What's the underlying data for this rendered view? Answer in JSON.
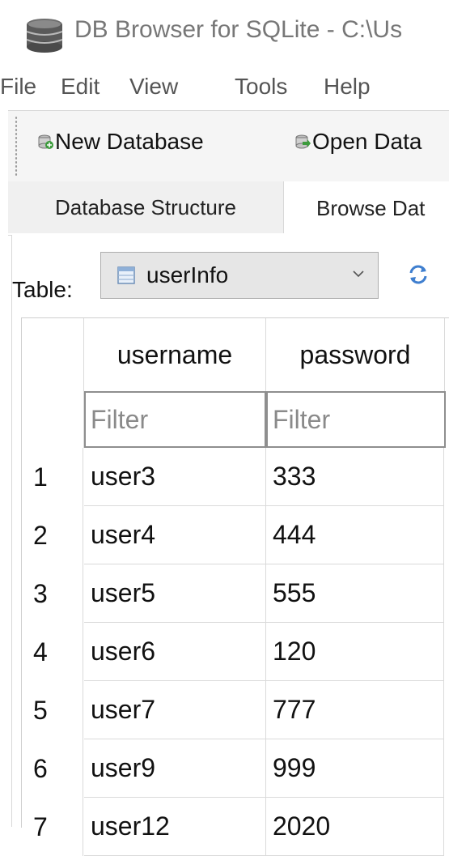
{
  "window": {
    "title": "DB Browser for SQLite - C:\\Us"
  },
  "menu": [
    "File",
    "Edit",
    "View",
    "Tools",
    "Help"
  ],
  "toolbar": {
    "new_database": "New Database",
    "open_database": "Open Data"
  },
  "tabs": {
    "database_structure": "Database Structure",
    "browse_data": "Browse Dat"
  },
  "browse": {
    "table_label": "Table:",
    "selected_table": "userInfo"
  },
  "grid": {
    "columns": [
      "username",
      "password"
    ],
    "filter_placeholder": "Filter",
    "rows": [
      {
        "num": "1",
        "username": "user3",
        "password": "333"
      },
      {
        "num": "2",
        "username": "user4",
        "password": "444"
      },
      {
        "num": "3",
        "username": "user5",
        "password": "555"
      },
      {
        "num": "4",
        "username": "user6",
        "password": "120"
      },
      {
        "num": "5",
        "username": "user7",
        "password": "777"
      },
      {
        "num": "6",
        "username": "user9",
        "password": "999"
      },
      {
        "num": "7",
        "username": "user12",
        "password": "2020"
      }
    ]
  },
  "colors": {
    "toolbar_bg": "#f5f5f5",
    "combo_bg": "#e6e6e6",
    "grid_line": "#dadada",
    "filter_text": "#8a8a8a"
  }
}
